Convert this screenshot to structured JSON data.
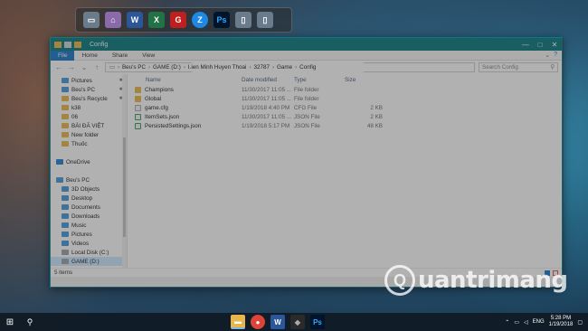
{
  "window": {
    "title": "Config",
    "controls": {
      "minimize": "—",
      "maximize": "□",
      "close": "✕"
    }
  },
  "ribbon": {
    "tabs": [
      "File",
      "Home",
      "Share",
      "View"
    ],
    "expand_glyph": "⌄",
    "help_glyph": "?"
  },
  "navbar": {
    "back": "←",
    "forward": "→",
    "up_recent": "⌄",
    "up": "↑",
    "breadcrumb": [
      "Beu's PC",
      "GAME (D:)",
      "Lien Minh Huyen Thoai",
      "32787",
      "Game",
      "Config"
    ],
    "separator": "›",
    "search_placeholder": "Search Config",
    "search_icon_glyph": "⚲"
  },
  "nav_pane": {
    "items": [
      {
        "label": "Pictures",
        "indent": true,
        "pinned": true,
        "icon": "pictures-icon",
        "color": "#4a9ad8"
      },
      {
        "label": "Beu's PC",
        "indent": true,
        "pinned": true,
        "icon": "pc-icon",
        "color": "#4a9ad8"
      },
      {
        "label": "Beu's Recycle",
        "indent": true,
        "pinned": true,
        "icon": "folder-icon",
        "color": "#e8b64a"
      },
      {
        "label": "k38",
        "indent": true,
        "pinned": false,
        "icon": "folder-icon",
        "color": "#e8b64a"
      },
      {
        "label": "06",
        "indent": true,
        "pinned": false,
        "icon": "folder-icon",
        "color": "#e8b64a"
      },
      {
        "label": "BÀI ĐĂ VIỆT",
        "indent": true,
        "pinned": false,
        "icon": "folder-icon",
        "color": "#e8b64a"
      },
      {
        "label": "New folder",
        "indent": true,
        "pinned": false,
        "icon": "folder-icon",
        "color": "#e8b64a"
      },
      {
        "label": "Thuốc",
        "indent": true,
        "pinned": false,
        "icon": "folder-icon",
        "color": "#e8b64a"
      },
      {
        "label": "",
        "indent": false,
        "pinned": false,
        "icon": "",
        "color": ""
      },
      {
        "label": "OneDrive",
        "indent": false,
        "pinned": false,
        "icon": "cloud-icon",
        "color": "#2d7fd3"
      },
      {
        "label": "",
        "indent": false,
        "pinned": false,
        "icon": "",
        "color": ""
      },
      {
        "label": "Beu's PC",
        "indent": false,
        "pinned": false,
        "icon": "pc-icon",
        "color": "#4a9ad8"
      },
      {
        "label": "3D Objects",
        "indent": true,
        "pinned": false,
        "icon": "cube-icon",
        "color": "#4a9ad8"
      },
      {
        "label": "Desktop",
        "indent": true,
        "pinned": false,
        "icon": "desktop-icon",
        "color": "#4a9ad8"
      },
      {
        "label": "Documents",
        "indent": true,
        "pinned": false,
        "icon": "documents-icon",
        "color": "#4a9ad8"
      },
      {
        "label": "Downloads",
        "indent": true,
        "pinned": false,
        "icon": "downloads-icon",
        "color": "#4a9ad8"
      },
      {
        "label": "Music",
        "indent": true,
        "pinned": false,
        "icon": "music-icon",
        "color": "#4a9ad8"
      },
      {
        "label": "Pictures",
        "indent": true,
        "pinned": false,
        "icon": "pictures-icon",
        "color": "#4a9ad8"
      },
      {
        "label": "Videos",
        "indent": true,
        "pinned": false,
        "icon": "videos-icon",
        "color": "#4a9ad8"
      },
      {
        "label": "Local Disk (C:)",
        "indent": true,
        "pinned": false,
        "icon": "disk-icon",
        "color": "#9aa3ab"
      },
      {
        "label": "GAME (D:)",
        "indent": true,
        "pinned": false,
        "icon": "disk-icon",
        "color": "#9aa3ab",
        "selected": true
      }
    ],
    "pin_glyph": "✱"
  },
  "list": {
    "headers": {
      "name": "Name",
      "date": "Date modified",
      "type": "Type",
      "size": "Size"
    },
    "rows": [
      {
        "name": "Champions",
        "date": "11/30/2017 11:05 ...",
        "type": "File folder",
        "size": "",
        "kind": "folder"
      },
      {
        "name": "Global",
        "date": "11/30/2017 11:05 ...",
        "type": "File folder",
        "size": "",
        "kind": "folder"
      },
      {
        "name": "game.cfg",
        "date": "1/19/2018 4:40 PM",
        "type": "CFG File",
        "size": "2 KB",
        "kind": "doc"
      },
      {
        "name": "ItemSets.json",
        "date": "11/30/2017 11:05 ...",
        "type": "JSON File",
        "size": "2 KB",
        "kind": "json"
      },
      {
        "name": "PersistedSettings.json",
        "date": "1/19/2018 5:17 PM",
        "type": "JSON File",
        "size": "48 KB",
        "kind": "json"
      }
    ]
  },
  "status": {
    "item_count": "5 items"
  },
  "watermark": {
    "circle_letter": "Q",
    "text": "uantrimang"
  },
  "taskbar": {
    "start_glyph": "⊞",
    "search_glyph": "⚲",
    "tray": {
      "lang": "ENG",
      "time": "5:28 PM",
      "date": "1/19/2018"
    }
  },
  "colors": {
    "accent": "#0a7a7e",
    "file_tab": "#1979ca",
    "folder": "#e8b64a"
  }
}
